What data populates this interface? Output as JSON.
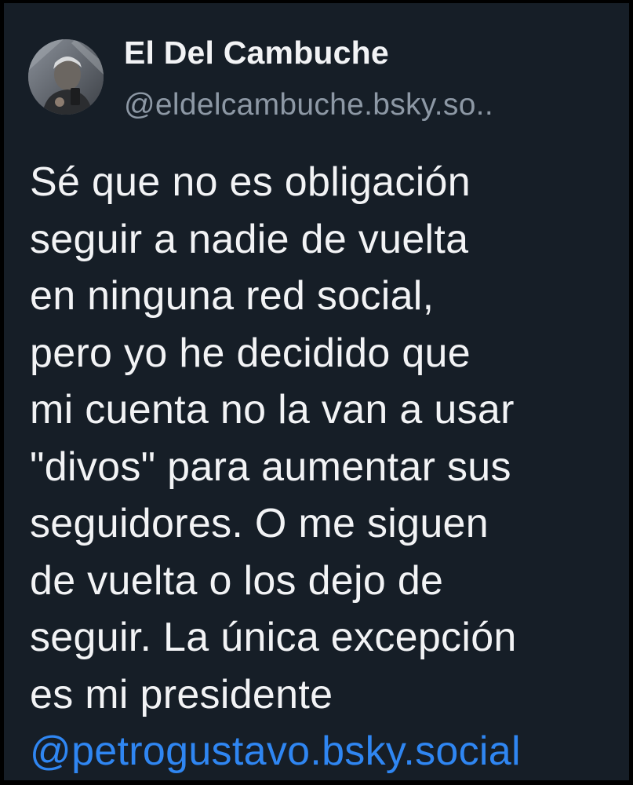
{
  "post": {
    "author": {
      "display_name": "El Del Cambuche",
      "handle": "@eldelcambuche.bsky.so.."
    },
    "body_lines": [
      "Sé que no es obligación",
      "seguir a nadie de vuelta",
      "en ninguna red social,",
      "pero yo he decidido que",
      "mi cuenta no la van a usar",
      "\"divos\" para aumentar sus",
      "seguidores. O me siguen",
      "de vuelta o los dejo de",
      "seguir. La única excepción",
      "es mi presidente"
    ],
    "mention": "@petrogustavo.bsky.social"
  },
  "colors": {
    "background": "#161e27",
    "text": "#f2f3f5",
    "handle": "#8d98a5",
    "mention": "#2f86f2"
  }
}
